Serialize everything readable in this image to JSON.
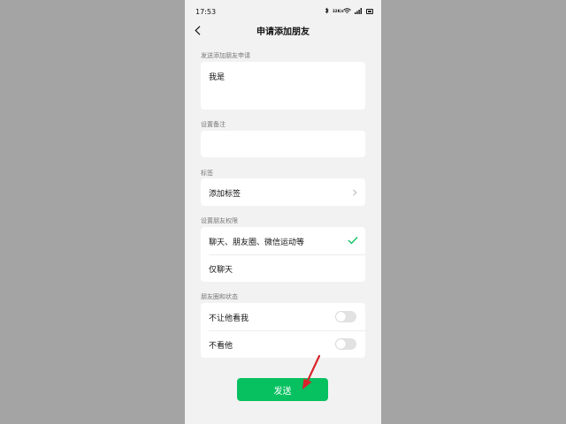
{
  "status_bar": {
    "time": "17:53",
    "icons": [
      "bluetooth-icon",
      "data-speed-icon",
      "wifi-icon",
      "signal-icon",
      "battery-icon"
    ],
    "speed_text": "32K/s"
  },
  "header": {
    "title": "申请添加朋友"
  },
  "request": {
    "label": "发送添加朋友申请",
    "value": "我是"
  },
  "remark": {
    "label": "设置备注",
    "value": ""
  },
  "tags": {
    "label": "标签",
    "add_label": "添加标签"
  },
  "permissions": {
    "label": "设置朋友权限",
    "options": [
      "聊天、朋友圈、微信运动等",
      "仅聊天"
    ],
    "selected": 0
  },
  "moments": {
    "label": "朋友圈和状态",
    "items": [
      {
        "label": "不让他看我",
        "on": false
      },
      {
        "label": "不看他",
        "on": false
      }
    ]
  },
  "send_label": "发送",
  "colors": {
    "accent": "#07c160",
    "background": "#f2f2f2",
    "arrow": "#d9232a"
  }
}
